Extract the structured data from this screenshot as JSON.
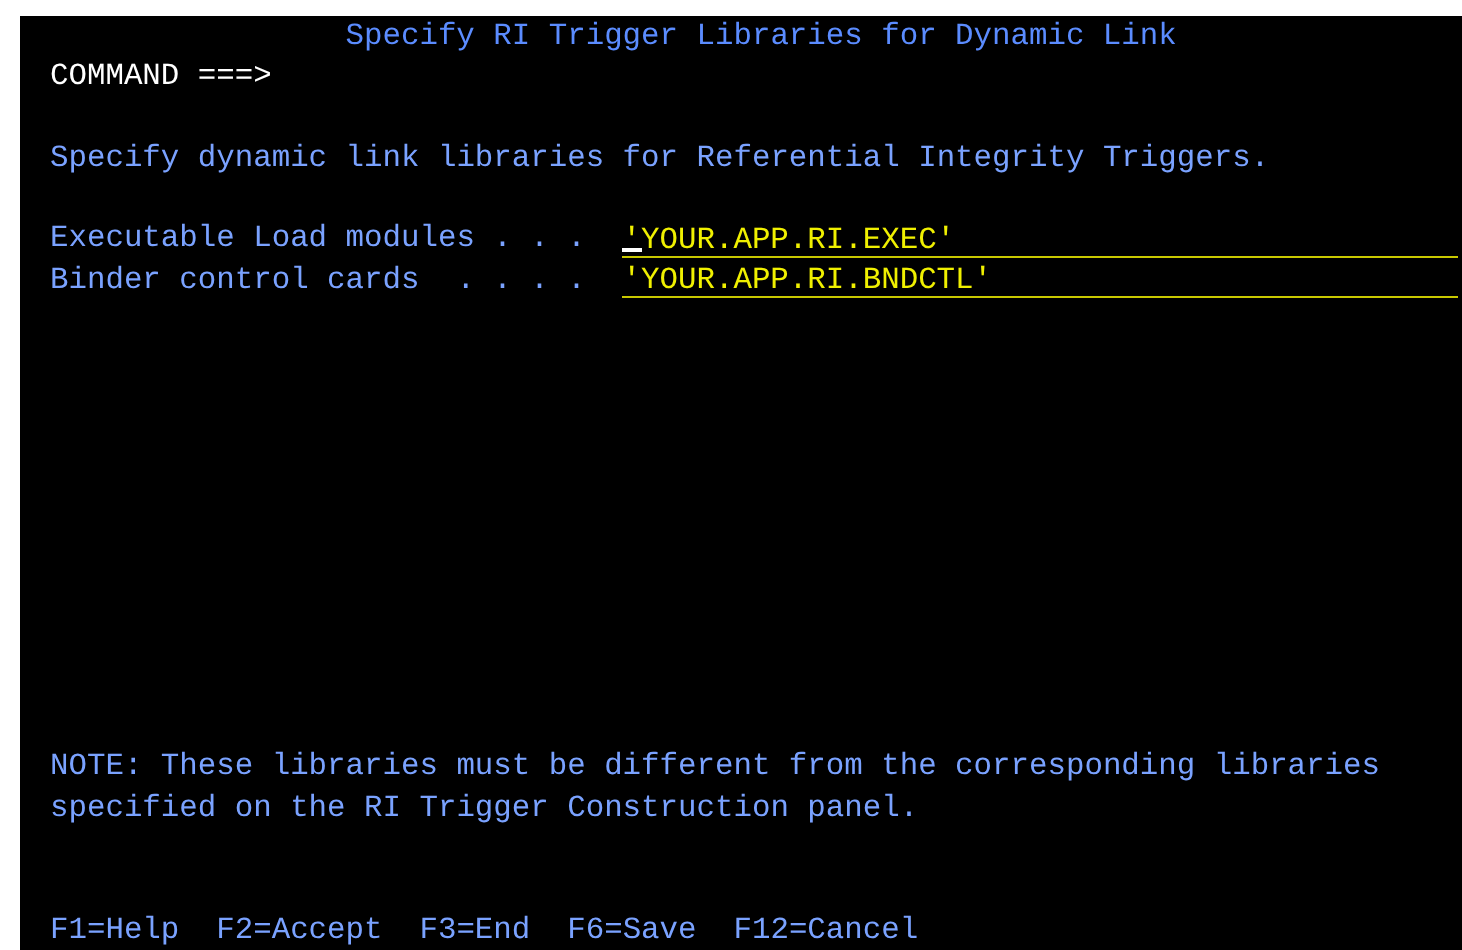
{
  "panel_title": "Specify RI Trigger Libraries for Dynamic Link",
  "command": {
    "label": "COMMAND ===>"
  },
  "instruction": "Specify dynamic link libraries for Referential Integrity Triggers.",
  "fields": [
    {
      "label": "Executable Load modules . . .",
      "value": "'YOUR.APP.RI.EXEC'",
      "focused": true
    },
    {
      "label": "Binder control cards  . . . .",
      "value": "'YOUR.APP.RI.BNDCTL'",
      "focused": false
    }
  ],
  "note": "NOTE: These libraries must be different from the corresponding libraries specified on the RI Trigger Construction panel.",
  "function_keys": [
    "F1=Help",
    "F2=Accept",
    "F3=End",
    "F6=Save",
    "F12=Cancel"
  ]
}
